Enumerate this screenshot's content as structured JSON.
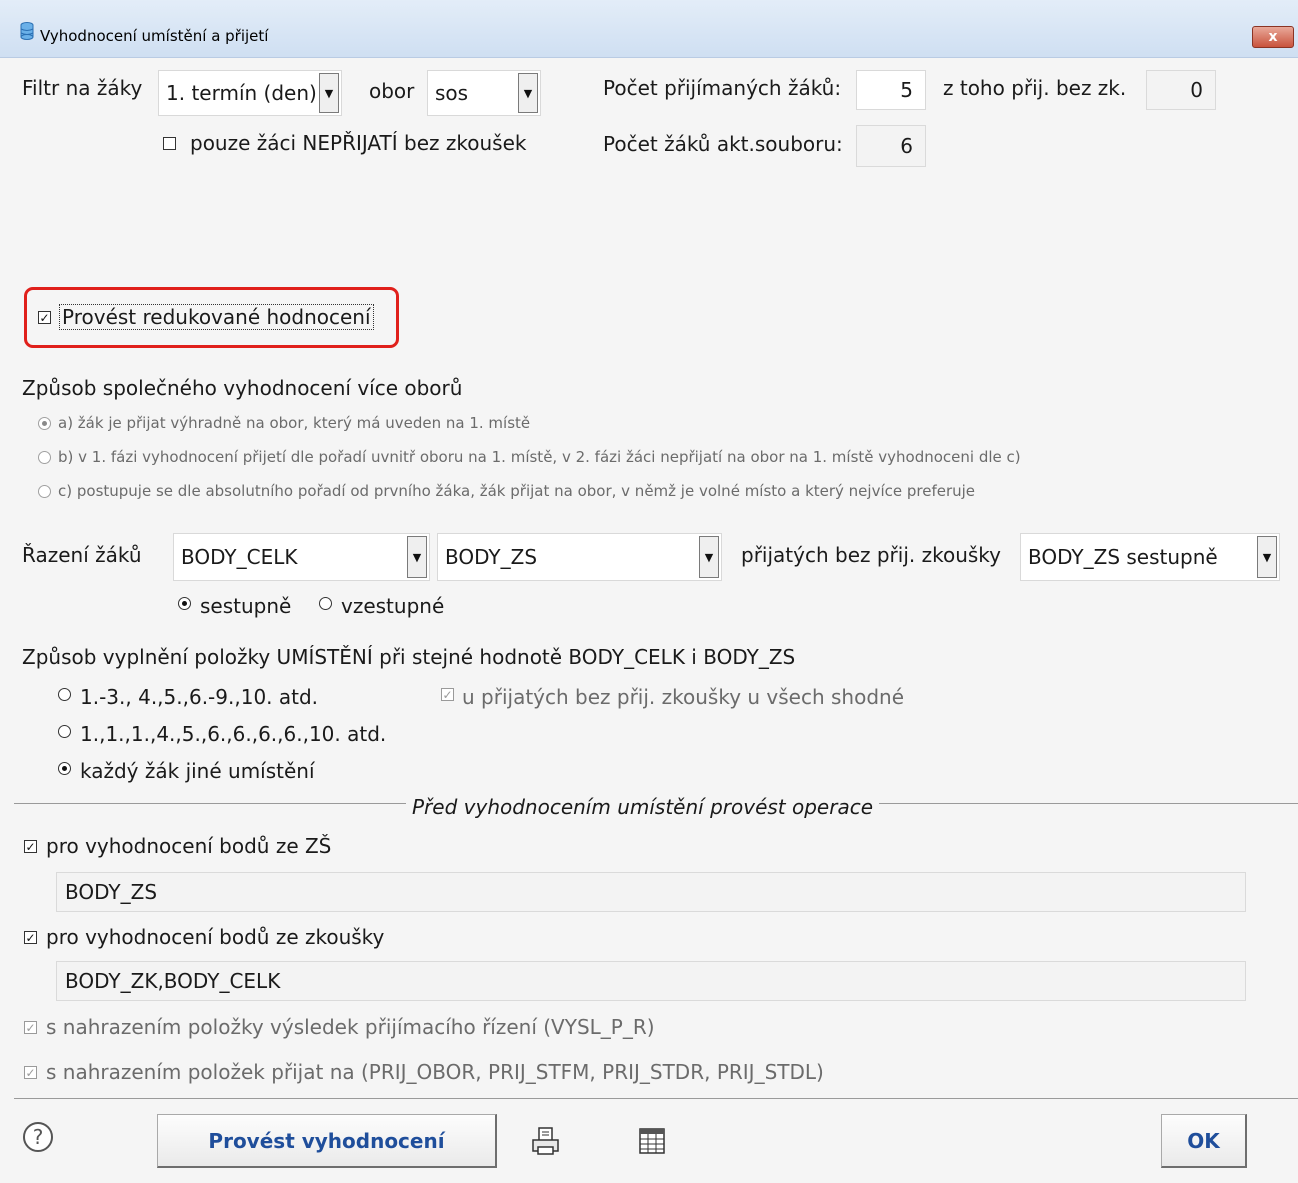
{
  "window": {
    "title": "Vyhodnocení umístění a přijetí",
    "close_label": "x"
  },
  "filter": {
    "label": "Filtr na žáky",
    "termin_value": "1. termín (den)",
    "obor_label": "obor",
    "obor_value": "sos",
    "only_not_admitted_label": "pouze žáci NEPŘIJATÍ bez zkoušek",
    "only_not_admitted_checked": false
  },
  "counts": {
    "admitted_label": "Počet přijímaných žáků:",
    "admitted_value": "5",
    "without_exam_label": "z toho přij. bez zk.",
    "without_exam_value": "0",
    "file_count_label": "Počet žáků akt.souboru:",
    "file_count_value": "6"
  },
  "reduced": {
    "label": "Provést redukované hodnocení",
    "checked": true
  },
  "method": {
    "heading": "Způsob společného vyhodnocení více oborů",
    "options": [
      {
        "label": "a) žák je přijat výhradně na obor, který má uveden na 1. místě",
        "selected": true
      },
      {
        "label": "b) v 1. fázi vyhodnocení přijetí dle pořadí uvnitř oboru na 1. místě, v 2. fázi žáci nepřijatí na obor na 1. místě vyhodnoceni dle c)",
        "selected": false
      },
      {
        "label": "c) postupuje se dle absolutního pořadí od prvního žáka, žák přijat na obor, v němž je volné místo a který nejvíce preferuje",
        "selected": false
      }
    ]
  },
  "sorting": {
    "label": "Řazení žáků",
    "field1": "BODY_CELK",
    "field2": "BODY_ZS",
    "without_exam_label": "přijatých bez přij. zkoušky",
    "without_exam_value": "BODY_ZS sestupně",
    "desc_label": "sestupně",
    "asc_label": "vzestupné",
    "direction": "desc"
  },
  "placement": {
    "heading": "Způsob vyplnění položky UMÍSTĚNÍ při stejné hodnotě BODY_CELK i BODY_ZS",
    "options": [
      {
        "label": "1.-3., 4.,5.,6.-9.,10. atd.",
        "selected": false
      },
      {
        "label": "1.,1.,1.,4.,5.,6.,6.,6.,6.,10. atd.",
        "selected": false
      },
      {
        "label": "každý žák jiné umístění",
        "selected": true
      }
    ],
    "same_for_all_label": "u přijatých bez přij. zkoušky u všech shodné",
    "same_for_all_checked": true
  },
  "operations": {
    "legend": "Před vyhodnocením umístění  provést operace",
    "zs_label": "pro vyhodnocení bodů ze ZŠ",
    "zs_checked": true,
    "zs_value": "BODY_ZS",
    "exam_label": "pro vyhodnocení bodů ze zkoušky",
    "exam_checked": true,
    "exam_value": "BODY_ZK,BODY_CELK",
    "replace_result_label": "s nahrazením položky výsledek přijímacího řízení (VYSL_P_R)",
    "replace_result_checked": true,
    "replace_admit_label": "s nahrazením položek přijat na (PRIJ_OBOR, PRIJ_STFM, PRIJ_STDR, PRIJ_STDL)",
    "replace_admit_checked": true
  },
  "footer": {
    "help_label": "?",
    "run_label": "Provést vyhodnocení",
    "ok_label": "OK",
    "print_icon": "printer-icon",
    "table_icon": "table-icon"
  },
  "colors": {
    "highlight": "#e0201b",
    "button_text": "#1f4e9b",
    "title_bg": "#d6e4f5"
  }
}
